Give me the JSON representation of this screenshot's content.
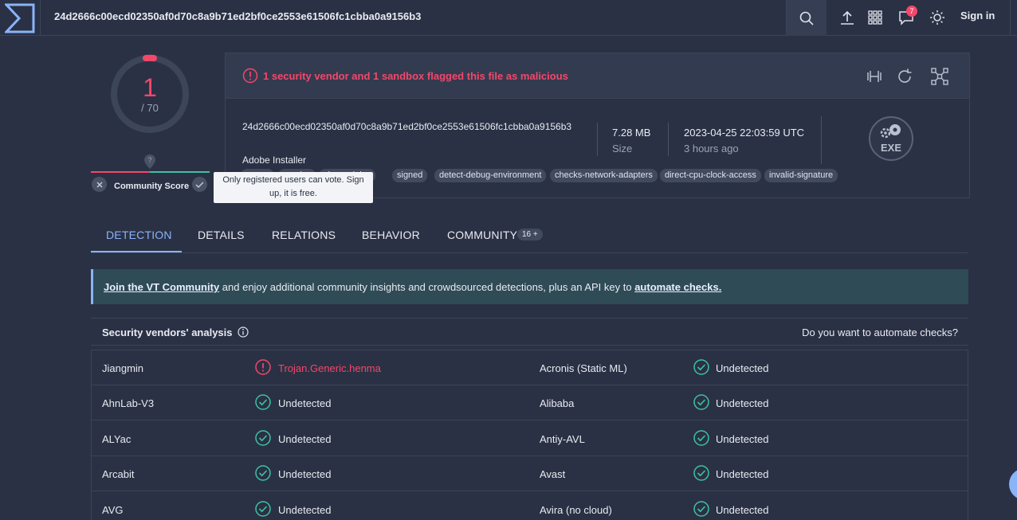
{
  "header": {
    "hash": "24d2666c00ecd02350af0d70c8a9b71ed2bf0ce2553e61506fc1cbba0a9156b3",
    "notification_count": "7",
    "signin_label": "Sign in"
  },
  "score": {
    "detected": "1",
    "total": "/ 70",
    "community_label": "Community Score",
    "community_tooltip": "Only registered users can vote. Sign up, it is free."
  },
  "summary": {
    "alert": "1 security vendor and 1 sandbox flagged this file as malicious",
    "hash": "24d2666c00ecd02350af0d70c8a9b71ed2bf0ce2553e61506fc1cbba0a9156b3",
    "name": "Adobe Installer",
    "size_value": "7.28 MB",
    "size_label": "Size",
    "date_value": "2023-04-25 22:03:59 UTC",
    "date_label": "3 hours ago",
    "file_type": "EXE",
    "tags": [
      "peexe",
      "overlay",
      "via-modules",
      "signed",
      "detect-debug-environment",
      "checks-network-adapters",
      "direct-cpu-clock-access",
      "invalid-signature"
    ]
  },
  "tabs": [
    {
      "label": "DETECTION"
    },
    {
      "label": "DETAILS"
    },
    {
      "label": "RELATIONS"
    },
    {
      "label": "BEHAVIOR"
    },
    {
      "label": "COMMUNITY",
      "count": "16 +"
    }
  ],
  "banner": {
    "link1": "Join the VT Community",
    "text": " and enjoy additional community insights and crowdsourced detections, plus an API key to ",
    "link2": "automate checks."
  },
  "vendors": {
    "title": "Security vendors' analysis",
    "automate_prompt": "Do you want to automate checks?",
    "rows": [
      [
        {
          "name": "Jiangmin",
          "result": "Trojan.Generic.henma",
          "malicious": true
        },
        {
          "name": "Acronis (Static ML)",
          "result": "Undetected"
        }
      ],
      [
        {
          "name": "AhnLab-V3",
          "result": "Undetected"
        },
        {
          "name": "Alibaba",
          "result": "Undetected"
        }
      ],
      [
        {
          "name": "ALYac",
          "result": "Undetected"
        },
        {
          "name": "Antiy-AVL",
          "result": "Undetected"
        }
      ],
      [
        {
          "name": "Arcabit",
          "result": "Undetected"
        },
        {
          "name": "Avast",
          "result": "Undetected"
        }
      ],
      [
        {
          "name": "AVG",
          "result": "Undetected"
        },
        {
          "name": "Avira (no cloud)",
          "result": "Undetected"
        }
      ]
    ]
  },
  "colors": {
    "malicious": "#f4476a",
    "clean": "#3fc1a1",
    "accent": "#8ab4f8",
    "background": "#2a3144"
  }
}
